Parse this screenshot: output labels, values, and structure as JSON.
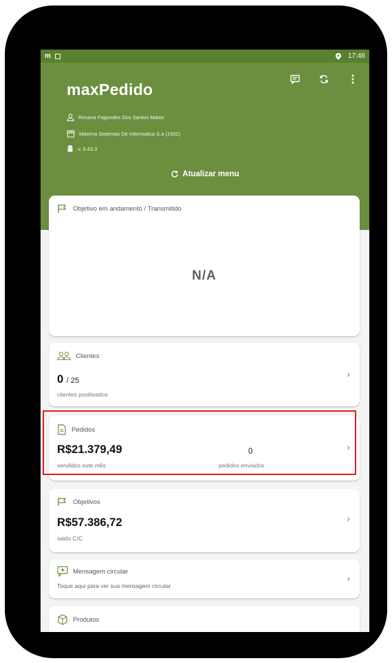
{
  "statusbar": {
    "left_glyph": "m",
    "time": "17:46"
  },
  "header": {
    "app_title": "maxPedido",
    "user_name": "Rosana Fagundes Dos Santos Matos",
    "company": "Máxima Sistemas De Informatica S.a (1502)",
    "version": "v. 3.43.3",
    "refresh_label": "Atualizar menu"
  },
  "cards": {
    "objetivo": {
      "title": "Objetivo em andamento / Transmitido",
      "value": "N/A"
    },
    "clientes": {
      "title": "Clientes",
      "value": "0",
      "value_suffix": "/ 25",
      "caption": "clientes positivados"
    },
    "pedidos": {
      "title": "Pedidos",
      "value": "R$21.379,49",
      "caption": "vendidos este mês",
      "sent_count": "0",
      "sent_caption": "pedidos enviados"
    },
    "objetivos": {
      "title": "Objetivos",
      "value": "R$57.386,72",
      "caption": "saldo C/C"
    },
    "mensagem": {
      "title": "Mensagem circular",
      "caption": "Toque aqui para ver sua mensagem circular"
    },
    "produtos": {
      "title": "Produtos"
    }
  },
  "colors": {
    "header_green": "#6b8f3e",
    "statusbar_green": "#59802f",
    "icon_green": "#6b8f3e",
    "highlight_red": "#e01e1e"
  }
}
